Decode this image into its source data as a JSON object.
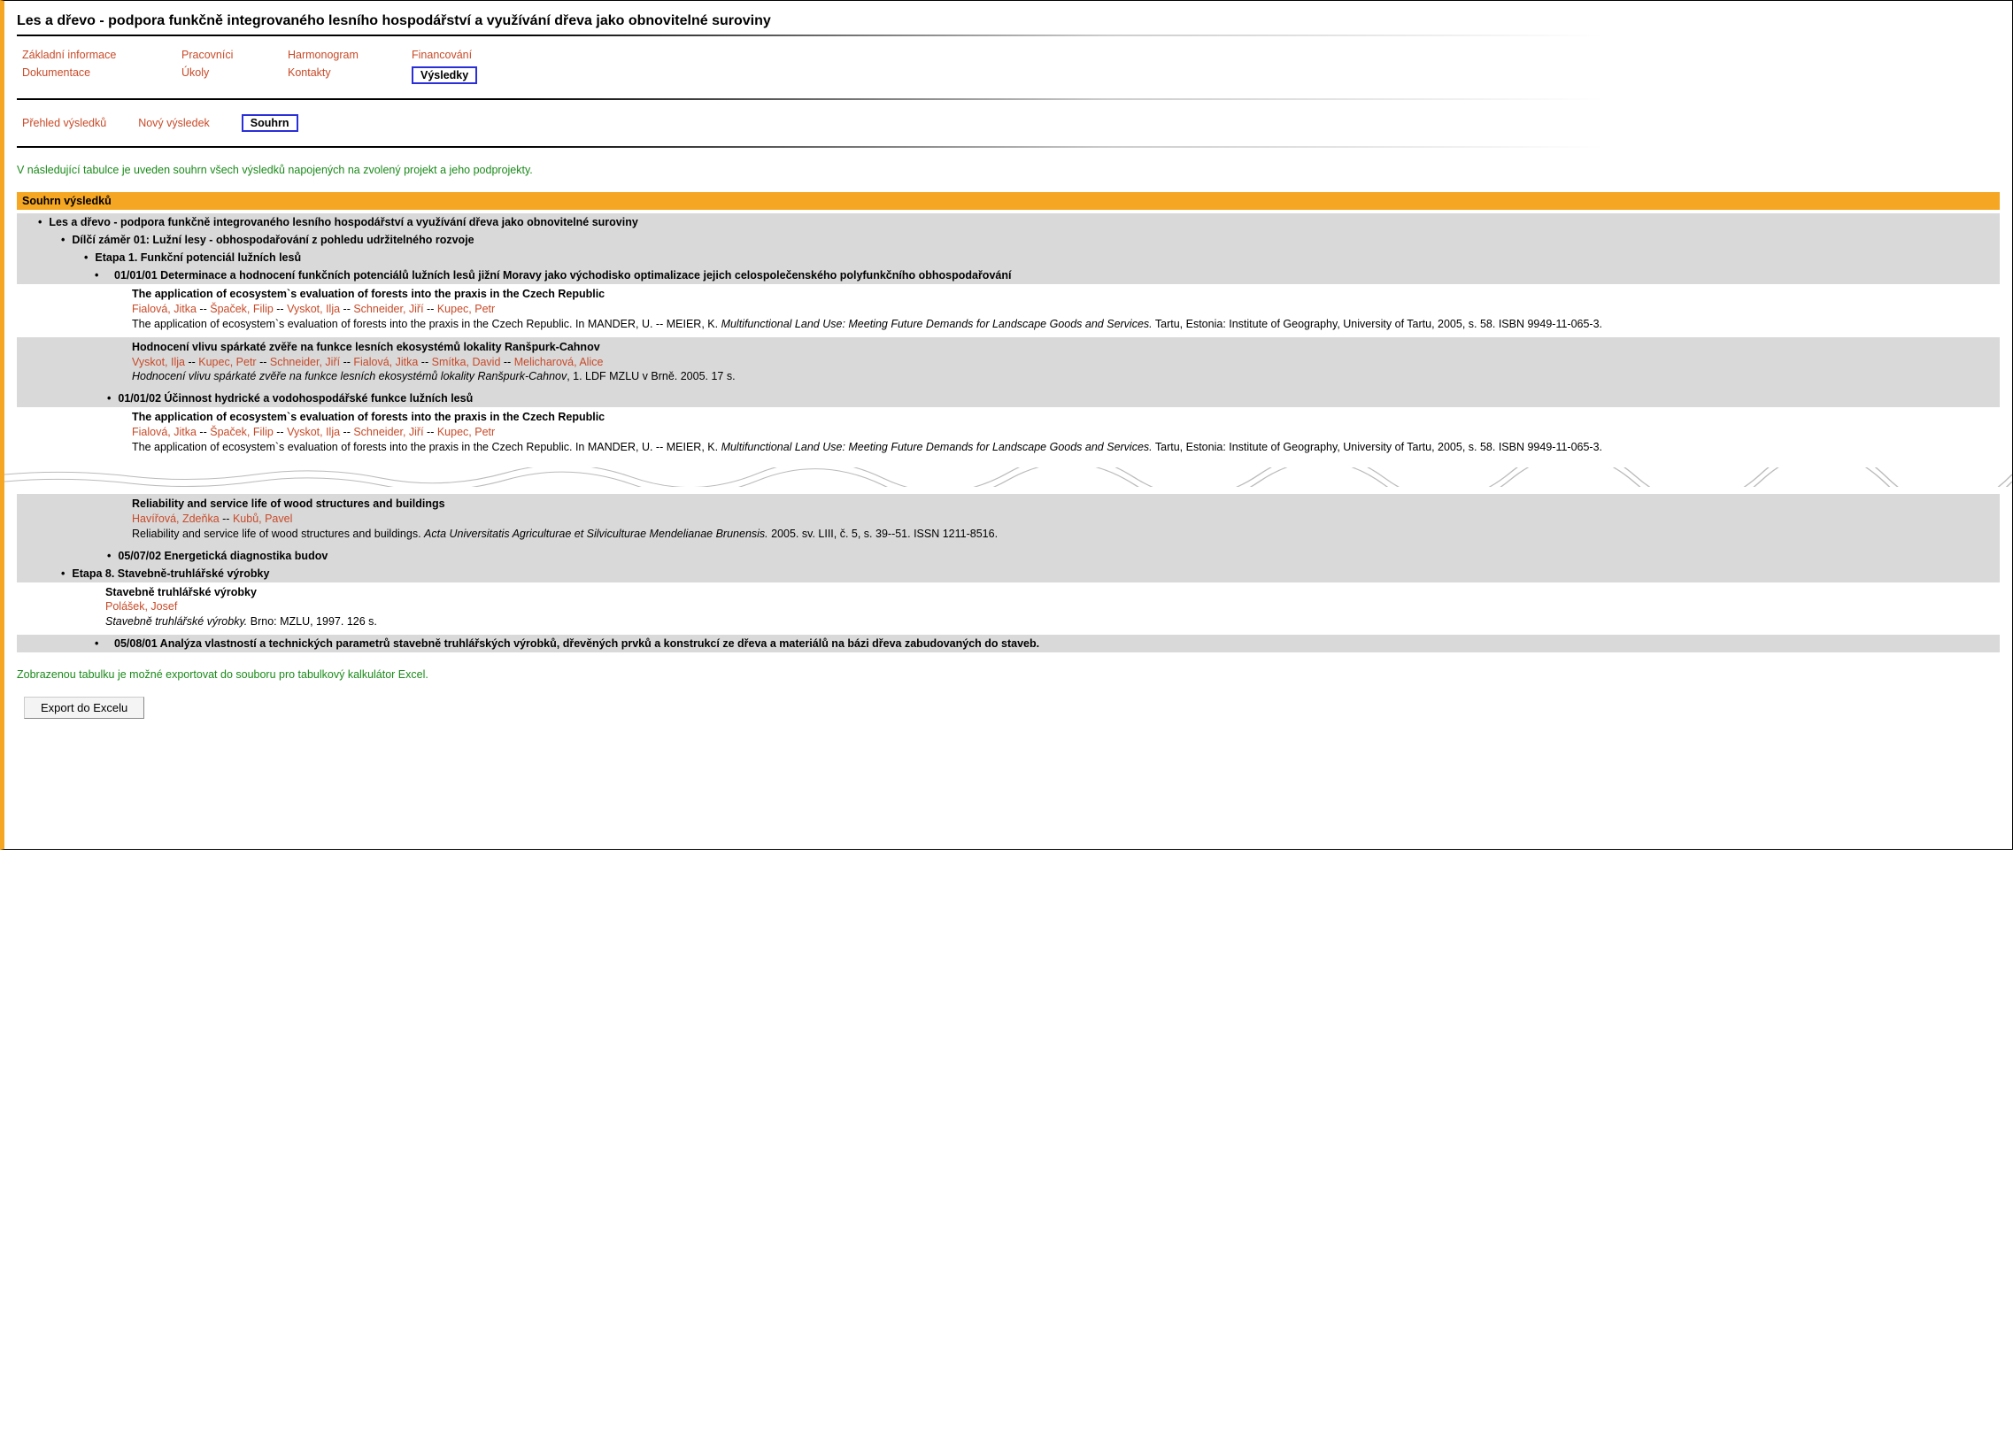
{
  "title": "Les a dřevo - podpora funkčně integrovaného lesního hospodářství a využívání dřeva jako obnovitelné suroviny",
  "nav": {
    "row1": [
      "Základní informace",
      "Pracovníci",
      "Harmonogram",
      "Financování"
    ],
    "row2": [
      "Dokumentace",
      "Úkoly",
      "Kontakty",
      "Výsledky"
    ],
    "active_primary": "Výsledky"
  },
  "subnav": {
    "items": [
      "Přehled výsledků",
      "Nový výsledek",
      "Souhrn"
    ],
    "active": "Souhrn"
  },
  "intro_note": "V následující tabulce je uveden souhrn všech výsledků napojených na zvolený projekt a jeho podprojekty.",
  "section_header": "Souhrn výsledků",
  "tree": {
    "project": "Les a dřevo - podpora funkčně integrovaného lesního hospodářství a využívání dřeva jako obnovitelné suroviny",
    "dilci": "Dílčí záměr 01: Lužní lesy - obhospodařování z pohledu udržitelného rozvoje",
    "etapa1": "Etapa 1. Funkční potenciál lužních lesů",
    "task_010101": "01/01/01 Determinace a hodnocení funkčních potenciálů lužních lesů jižní Moravy jako východisko optimalizace jejich celospolečenského polyfunkčního obhospodařování",
    "task_010102": "01/01/02 Účinnost hydrické a vodohospodářské funkce lužních lesů",
    "task_050702": "05/07/02 Energetická diagnostika budov",
    "etapa8": "Etapa 8. Stavebně-truhlářské výrobky",
    "task_050801": "05/08/01 Analýza vlastností a technických parametrů stavebně truhlářských výrobků, dřevěných prvků a konstrukcí ze dřeva a materiálů na bázi dřeva zabudovaných do staveb."
  },
  "pubs": {
    "p1": {
      "title": "The application of ecosystem`s evaluation of forests into the praxis in the Czech Republic",
      "authors": [
        "Fialová, Jitka",
        "Špaček, Filip",
        "Vyskot, Ilja",
        "Schneider, Jiří",
        "Kupec, Petr"
      ],
      "citation_pre": "The application of ecosystem`s evaluation of forests into the praxis in the Czech Republic. In MANDER, U. -- MEIER, K. ",
      "citation_ital": "Multifunctional Land Use: Meeting Future Demands for Landscape Goods and Services.",
      "citation_post": " Tartu, Estonia: Institute of Geography, University of Tartu, 2005, s. 58. ISBN 9949-11-065-3."
    },
    "p2": {
      "title": "Hodnocení vlivu spárkaté zvěře na funkce lesních ekosystémů lokality Ranšpurk-Cahnov",
      "authors": [
        "Vyskot, Ilja",
        "Kupec, Petr",
        "Schneider, Jiří",
        "Fialová, Jitka",
        "Smítka, David",
        "Melicharová, Alice"
      ],
      "citation_ital": "Hodnocení vlivu spárkaté zvěře na funkce lesních ekosystémů lokality Ranšpurk-Cahnov",
      "citation_post": ", 1. LDF MZLU v Brně. 2005. 17 s."
    },
    "p3": {
      "title": "The application of ecosystem`s evaluation of forests into the praxis in the Czech Republic",
      "authors": [
        "Fialová, Jitka",
        "Špaček, Filip",
        "Vyskot, Ilja",
        "Schneider, Jiří",
        "Kupec, Petr"
      ],
      "citation_pre": "The application of ecosystem`s evaluation of forests into the praxis in the Czech Republic. In MANDER, U. -- MEIER, K. ",
      "citation_ital": "Multifunctional Land Use: Meeting Future Demands for Landscape Goods and Services.",
      "citation_post": " Tartu, Estonia: Institute of Geography, University of Tartu, 2005, s. 58. ISBN 9949-11-065-3."
    },
    "p4": {
      "title": "Reliability and service life of wood structures and buildings",
      "authors": [
        "Havířová, Zdeňka",
        "Kubů, Pavel"
      ],
      "citation_pre": "Reliability and service life of wood structures and buildings. ",
      "citation_ital": "Acta Universitatis Agriculturae et Silviculturae Mendelianae Brunensis.",
      "citation_post": " 2005. sv. LIII, č. 5, s. 39--51. ISSN 1211-8516."
    },
    "p5": {
      "title": "Stavebně truhlářské výrobky",
      "authors": [
        "Polášek, Josef"
      ],
      "citation_ital": "Stavebně truhlářské výrobky.",
      "citation_post": " Brno: MZLU, 1997. 126 s."
    }
  },
  "export_note": "Zobrazenou tabulku je možné exportovat do souboru pro tabulkový kalkulátor Excel.",
  "export_button": "Export do Excelu"
}
